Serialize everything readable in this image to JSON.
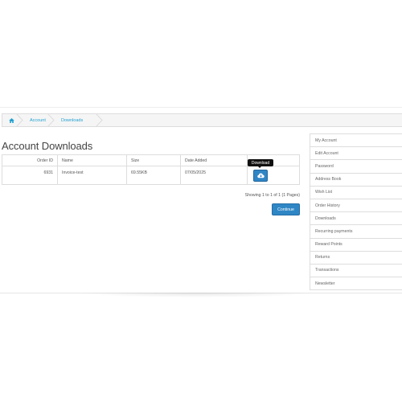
{
  "breadcrumb": {
    "home_icon": "home-icon",
    "items": [
      "Account",
      "Downloads"
    ]
  },
  "page": {
    "title": "Account Downloads"
  },
  "table": {
    "headers": [
      "Order ID",
      "Name",
      "Size",
      "Date Added"
    ],
    "rows": [
      {
        "order_id": "6931",
        "name": "Invoice-test",
        "size": "69.55KB",
        "date_added": "07/05/2025"
      }
    ],
    "download_tooltip": "Download",
    "download_icon": "cloud-download-icon"
  },
  "pagination": {
    "text": "Showing 1 to 1 of 1 (1 Pages)"
  },
  "actions": {
    "continue_label": "Continue"
  },
  "sidebar": {
    "items": [
      "My Account",
      "Edit Account",
      "Password",
      "Address Book",
      "Wish List",
      "Order History",
      "Downloads",
      "Recurring payments",
      "Reward Points",
      "Returns",
      "Transactions",
      "Newsletter"
    ]
  },
  "colors": {
    "link": "#23a1d1",
    "button": "#2f86c5",
    "tooltip": "#111111"
  }
}
